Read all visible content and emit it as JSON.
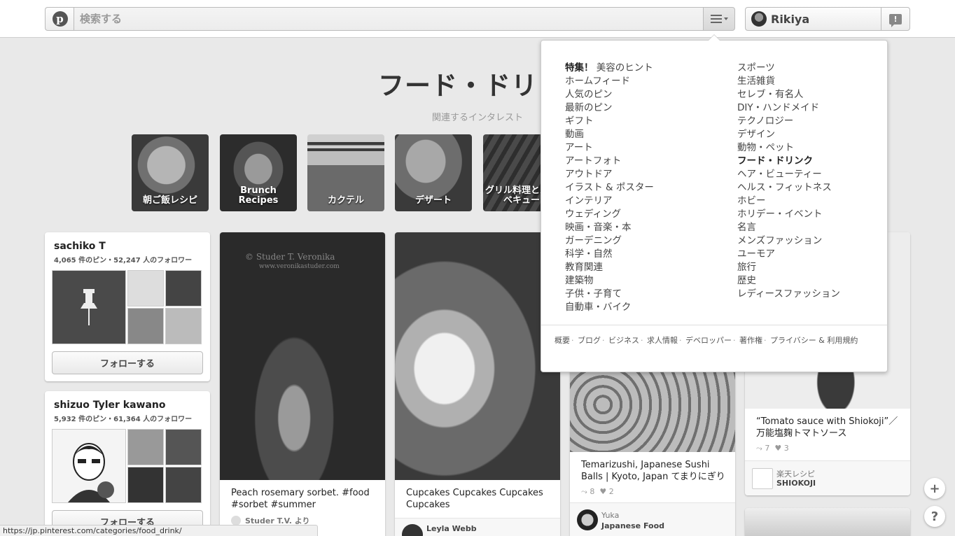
{
  "header": {
    "logo_letter": "p",
    "search_placeholder": "検索する",
    "user_name": "Rikiya",
    "notif_glyph": "!"
  },
  "category": {
    "title": "フード・ドリンク",
    "related_label": "関連するインタレスト",
    "interests": [
      "朝ご飯レシピ",
      "Brunch Recipes",
      "カクテル",
      "デザート",
      "グリル料理とバーベキュー"
    ]
  },
  "boards": [
    {
      "name": "sachiko T",
      "stats": "4,065 件のピン・52,247 人のフォロワー",
      "follow_label": "フォローする"
    },
    {
      "name": "shizuo Tyler kawano",
      "stats": "5,932 件のピン・61,364 人のフォロワー",
      "follow_label": "フォローする"
    }
  ],
  "pins": [
    {
      "watermark": "© Studer T. Veronika",
      "watermark_url": "www.veronikastuder.com",
      "desc": "Peach rosemary sorbet. #food #sorbet #summer",
      "source": "Studer T.V. より"
    },
    {
      "desc": "Cupcakes Cupcakes Cupcakes Cupcakes",
      "user": "Leyla Webb"
    },
    {
      "desc": "Temarizushi, Japanese Sushi Balls | Kyoto, Japan てまりにぎり",
      "repins": "8",
      "likes": "2",
      "user": "Yuka",
      "board": "Japanese Food"
    },
    {
      "desc": "“Tomato sauce with Shiokoji”／万能塩麹トマトソース",
      "repins": "7",
      "likes": "3",
      "user": "楽天レシピ",
      "board": "SHIOKOJI"
    }
  ],
  "menu": {
    "featured_prefix": "特集！",
    "featured_label": "美容のヒント",
    "left": [
      "ホームフィード",
      "人気のピン",
      "最新のピン",
      "ギフト",
      "動画",
      "アート",
      "アートフォト",
      "アウトドア",
      "イラスト & ポスター",
      "インテリア",
      "ウェディング",
      "映画・音楽・本",
      "ガーデニング",
      "科学・自然",
      "教育関連",
      "建築物",
      "子供・子育て",
      "自動車・バイク"
    ],
    "right": [
      "スポーツ",
      "生活雑貨",
      "セレブ・有名人",
      "DIY・ハンドメイド",
      "テクノロジー",
      "デザイン",
      "動物・ペット",
      "フード・ドリンク",
      "ヘア・ビューティー",
      "ヘルス・フィットネス",
      "ホビー",
      "ホリデー・イベント",
      "名言",
      "メンズファッション",
      "ユーモア",
      "旅行",
      "歴史",
      "レディースファッション"
    ],
    "footer": [
      "概要",
      "ブログ",
      "ビジネス",
      "求人情報",
      "デベロッパー",
      "著作権",
      "プライバシー & 利用規約"
    ]
  },
  "floating": {
    "add": "+",
    "help": "?"
  },
  "status_url": "https://jp.pinterest.com/categories/food_drink/"
}
